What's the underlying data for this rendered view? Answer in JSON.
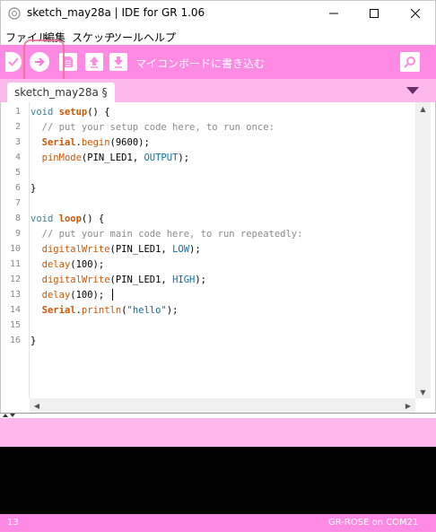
{
  "window": {
    "title": "sketch_may28a | IDE for GR 1.06",
    "icon": "app-logo-icon",
    "controls": [
      "minimize-icon",
      "maximize-icon",
      "close-icon"
    ]
  },
  "menu": [
    "ファイル",
    "編集",
    "スケッチ",
    "ツール",
    "ヘルプ"
  ],
  "toolbar": {
    "buttons": [
      "verify-icon",
      "upload-icon",
      "new-icon",
      "open-icon",
      "save-icon"
    ],
    "status": "マイコンボードに書き込む",
    "serial_monitor": "serial-monitor-icon"
  },
  "tab": {
    "label": "sketch_may28a §",
    "menu_icon": "tab-menu-icon"
  },
  "code": {
    "line_numbers": [
      "1",
      "2",
      "3",
      "4",
      "5",
      "6",
      "7",
      "8",
      "9",
      "10",
      "11",
      "12",
      "13",
      "14",
      "15",
      "16"
    ],
    "lines": [
      "void setup() {",
      "  // put your setup code here, to run once:",
      "  Serial.begin(9600);",
      "  pinMode(PIN_LED1, OUTPUT);",
      "",
      "}",
      "",
      "void loop() {",
      "  // put your main code here, to run repeatedly:",
      "  digitalWrite(PIN_LED1, LOW);",
      "  delay(100);",
      "  digitalWrite(PIN_LED1, HIGH);",
      "  delay(100);",
      "  Serial.println(\"hello\");",
      "",
      "}"
    ]
  },
  "statusbar": {
    "line": "13",
    "board": "GR-ROSE on COM21"
  },
  "colors": {
    "toolbar": "#ff8ae3",
    "tabbar": "#ffb8ec",
    "console": "#000000",
    "highlight": "#f06a8e"
  }
}
